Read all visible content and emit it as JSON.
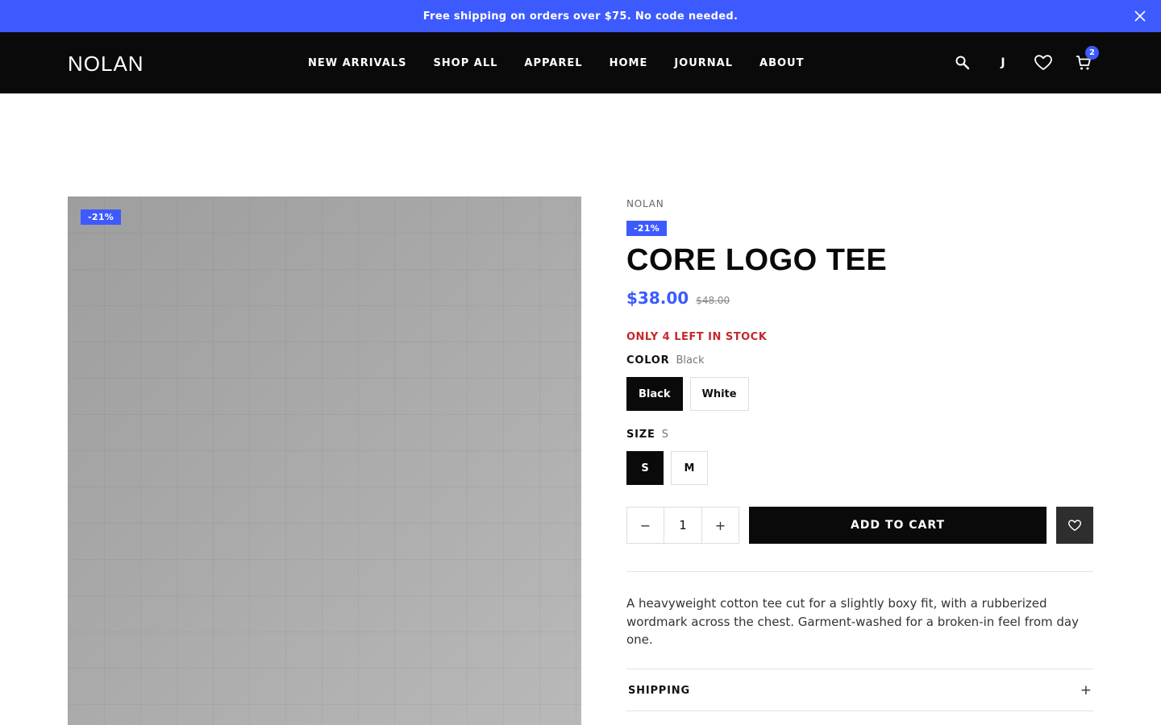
{
  "announcement": {
    "text": "Free shipping on orders over $75. No code needed.",
    "close_icon": "close-icon"
  },
  "header": {
    "logo": "NOLAN",
    "nav": [
      "NEW ARRIVALS",
      "SHOP ALL",
      "APPAREL",
      "HOME",
      "JOURNAL",
      "ABOUT"
    ],
    "account_initial": "J",
    "cart_count": "2",
    "icons": [
      "search-icon",
      "account-icon",
      "heart-icon",
      "cart-icon"
    ]
  },
  "gallery": {
    "badge": "-21%"
  },
  "product": {
    "brand": "NOLAN",
    "badge": "-21%",
    "title": "CORE LOGO TEE",
    "price": "$38.00",
    "compare_price": "$48.00",
    "stock": "ONLY 4 LEFT IN STOCK",
    "color_label": "COLOR",
    "color_value": "Black",
    "colors": [
      "Black",
      "White"
    ],
    "size_label": "SIZE",
    "size_value": "S",
    "sizes": [
      "S",
      "M"
    ],
    "quantity": "1",
    "qty_minus": "−",
    "qty_plus": "+",
    "add_to_cart": "ADD TO CART",
    "description": "A heavyweight cotton tee cut for a slightly boxy fit, with a rubberized wordmark across the chest. Garment-washed for a broken-in feel from day one.",
    "accordion_title": "SHIPPING",
    "accordion_icon": "+"
  },
  "colors": {
    "accent": "#3d5afe",
    "header_bg": "#0a0a0a",
    "stock_red": "#c62828"
  }
}
